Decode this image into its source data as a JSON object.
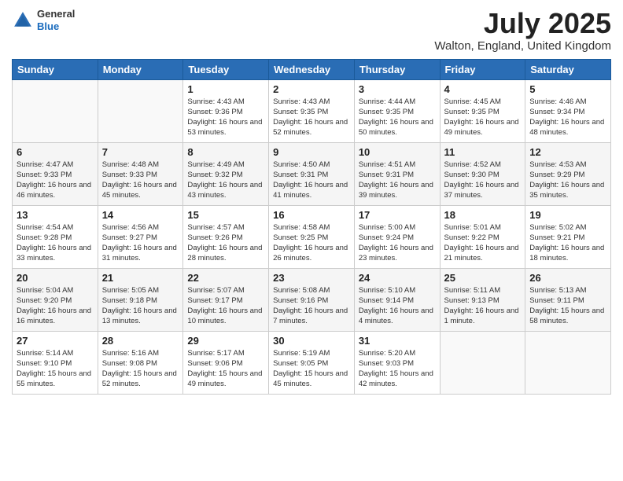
{
  "header": {
    "logo_general": "General",
    "logo_blue": "Blue",
    "month_title": "July 2025",
    "location": "Walton, England, United Kingdom"
  },
  "weekdays": [
    "Sunday",
    "Monday",
    "Tuesday",
    "Wednesday",
    "Thursday",
    "Friday",
    "Saturday"
  ],
  "weeks": [
    [
      {
        "day": "",
        "sunrise": "",
        "sunset": "",
        "daylight": ""
      },
      {
        "day": "",
        "sunrise": "",
        "sunset": "",
        "daylight": ""
      },
      {
        "day": "1",
        "sunrise": "Sunrise: 4:43 AM",
        "sunset": "Sunset: 9:36 PM",
        "daylight": "Daylight: 16 hours and 53 minutes."
      },
      {
        "day": "2",
        "sunrise": "Sunrise: 4:43 AM",
        "sunset": "Sunset: 9:35 PM",
        "daylight": "Daylight: 16 hours and 52 minutes."
      },
      {
        "day": "3",
        "sunrise": "Sunrise: 4:44 AM",
        "sunset": "Sunset: 9:35 PM",
        "daylight": "Daylight: 16 hours and 50 minutes."
      },
      {
        "day": "4",
        "sunrise": "Sunrise: 4:45 AM",
        "sunset": "Sunset: 9:35 PM",
        "daylight": "Daylight: 16 hours and 49 minutes."
      },
      {
        "day": "5",
        "sunrise": "Sunrise: 4:46 AM",
        "sunset": "Sunset: 9:34 PM",
        "daylight": "Daylight: 16 hours and 48 minutes."
      }
    ],
    [
      {
        "day": "6",
        "sunrise": "Sunrise: 4:47 AM",
        "sunset": "Sunset: 9:33 PM",
        "daylight": "Daylight: 16 hours and 46 minutes."
      },
      {
        "day": "7",
        "sunrise": "Sunrise: 4:48 AM",
        "sunset": "Sunset: 9:33 PM",
        "daylight": "Daylight: 16 hours and 45 minutes."
      },
      {
        "day": "8",
        "sunrise": "Sunrise: 4:49 AM",
        "sunset": "Sunset: 9:32 PM",
        "daylight": "Daylight: 16 hours and 43 minutes."
      },
      {
        "day": "9",
        "sunrise": "Sunrise: 4:50 AM",
        "sunset": "Sunset: 9:31 PM",
        "daylight": "Daylight: 16 hours and 41 minutes."
      },
      {
        "day": "10",
        "sunrise": "Sunrise: 4:51 AM",
        "sunset": "Sunset: 9:31 PM",
        "daylight": "Daylight: 16 hours and 39 minutes."
      },
      {
        "day": "11",
        "sunrise": "Sunrise: 4:52 AM",
        "sunset": "Sunset: 9:30 PM",
        "daylight": "Daylight: 16 hours and 37 minutes."
      },
      {
        "day": "12",
        "sunrise": "Sunrise: 4:53 AM",
        "sunset": "Sunset: 9:29 PM",
        "daylight": "Daylight: 16 hours and 35 minutes."
      }
    ],
    [
      {
        "day": "13",
        "sunrise": "Sunrise: 4:54 AM",
        "sunset": "Sunset: 9:28 PM",
        "daylight": "Daylight: 16 hours and 33 minutes."
      },
      {
        "day": "14",
        "sunrise": "Sunrise: 4:56 AM",
        "sunset": "Sunset: 9:27 PM",
        "daylight": "Daylight: 16 hours and 31 minutes."
      },
      {
        "day": "15",
        "sunrise": "Sunrise: 4:57 AM",
        "sunset": "Sunset: 9:26 PM",
        "daylight": "Daylight: 16 hours and 28 minutes."
      },
      {
        "day": "16",
        "sunrise": "Sunrise: 4:58 AM",
        "sunset": "Sunset: 9:25 PM",
        "daylight": "Daylight: 16 hours and 26 minutes."
      },
      {
        "day": "17",
        "sunrise": "Sunrise: 5:00 AM",
        "sunset": "Sunset: 9:24 PM",
        "daylight": "Daylight: 16 hours and 23 minutes."
      },
      {
        "day": "18",
        "sunrise": "Sunrise: 5:01 AM",
        "sunset": "Sunset: 9:22 PM",
        "daylight": "Daylight: 16 hours and 21 minutes."
      },
      {
        "day": "19",
        "sunrise": "Sunrise: 5:02 AM",
        "sunset": "Sunset: 9:21 PM",
        "daylight": "Daylight: 16 hours and 18 minutes."
      }
    ],
    [
      {
        "day": "20",
        "sunrise": "Sunrise: 5:04 AM",
        "sunset": "Sunset: 9:20 PM",
        "daylight": "Daylight: 16 hours and 16 minutes."
      },
      {
        "day": "21",
        "sunrise": "Sunrise: 5:05 AM",
        "sunset": "Sunset: 9:18 PM",
        "daylight": "Daylight: 16 hours and 13 minutes."
      },
      {
        "day": "22",
        "sunrise": "Sunrise: 5:07 AM",
        "sunset": "Sunset: 9:17 PM",
        "daylight": "Daylight: 16 hours and 10 minutes."
      },
      {
        "day": "23",
        "sunrise": "Sunrise: 5:08 AM",
        "sunset": "Sunset: 9:16 PM",
        "daylight": "Daylight: 16 hours and 7 minutes."
      },
      {
        "day": "24",
        "sunrise": "Sunrise: 5:10 AM",
        "sunset": "Sunset: 9:14 PM",
        "daylight": "Daylight: 16 hours and 4 minutes."
      },
      {
        "day": "25",
        "sunrise": "Sunrise: 5:11 AM",
        "sunset": "Sunset: 9:13 PM",
        "daylight": "Daylight: 16 hours and 1 minute."
      },
      {
        "day": "26",
        "sunrise": "Sunrise: 5:13 AM",
        "sunset": "Sunset: 9:11 PM",
        "daylight": "Daylight: 15 hours and 58 minutes."
      }
    ],
    [
      {
        "day": "27",
        "sunrise": "Sunrise: 5:14 AM",
        "sunset": "Sunset: 9:10 PM",
        "daylight": "Daylight: 15 hours and 55 minutes."
      },
      {
        "day": "28",
        "sunrise": "Sunrise: 5:16 AM",
        "sunset": "Sunset: 9:08 PM",
        "daylight": "Daylight: 15 hours and 52 minutes."
      },
      {
        "day": "29",
        "sunrise": "Sunrise: 5:17 AM",
        "sunset": "Sunset: 9:06 PM",
        "daylight": "Daylight: 15 hours and 49 minutes."
      },
      {
        "day": "30",
        "sunrise": "Sunrise: 5:19 AM",
        "sunset": "Sunset: 9:05 PM",
        "daylight": "Daylight: 15 hours and 45 minutes."
      },
      {
        "day": "31",
        "sunrise": "Sunrise: 5:20 AM",
        "sunset": "Sunset: 9:03 PM",
        "daylight": "Daylight: 15 hours and 42 minutes."
      },
      {
        "day": "",
        "sunrise": "",
        "sunset": "",
        "daylight": ""
      },
      {
        "day": "",
        "sunrise": "",
        "sunset": "",
        "daylight": ""
      }
    ]
  ]
}
